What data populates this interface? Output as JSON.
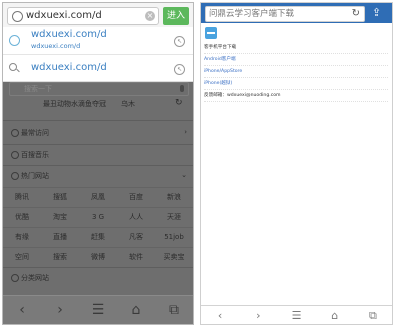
{
  "left_screen": {
    "url_value": "wdxuexi.com/d",
    "go_label": "进入",
    "suggestions": [
      {
        "title": "wdxuexi.com/d",
        "subtitle": "wdxuexi.com/d"
      },
      {
        "title": "wdxuexi.com/d"
      }
    ],
    "search_placeholder": "搜索一下",
    "news": [
      "最丑动物水滴鱼夺冠",
      "乌木"
    ],
    "sections": {
      "frequent": "最常访问",
      "music": "百搜音乐",
      "hot_sites": "热门网站",
      "categories": "分类网站"
    },
    "hot_grid": [
      [
        "腾讯",
        "搜狐",
        "凤凰",
        "百度",
        "新浪"
      ],
      [
        "优酷",
        "淘宝",
        "3 G",
        "人人",
        "天涯"
      ],
      [
        "有缘",
        "直播",
        "赶集",
        "凡客",
        "51job"
      ],
      [
        "空间",
        "搜索",
        "微博",
        "软件",
        "买卖宝"
      ]
    ],
    "bottom_nav": [
      {
        "icon": "back-icon",
        "glyph": "‹"
      },
      {
        "icon": "forward-icon",
        "glyph": "›"
      },
      {
        "icon": "menu-icon",
        "glyph": "☰"
      },
      {
        "icon": "home-icon",
        "glyph": "⌂"
      },
      {
        "icon": "tabs-icon",
        "glyph": "⧉"
      }
    ]
  },
  "right_screen": {
    "search_placeholder": "问鼎云学习客户端下载",
    "lines": [
      {
        "text": "客手机平台下载",
        "style": "dark"
      },
      {
        "text": "Android客户端",
        "style": "link"
      },
      {
        "text": "iPhone/AppStore",
        "style": "link"
      },
      {
        "text": "iPhone(越狱)",
        "style": "link"
      },
      {
        "text": "反馈邮箱：wdxuexi@nuoding.com",
        "style": "dark"
      }
    ],
    "bottom_nav": [
      {
        "icon": "back-icon",
        "glyph": "‹"
      },
      {
        "icon": "forward-icon",
        "glyph": "›"
      },
      {
        "icon": "menu-icon",
        "glyph": "☰"
      },
      {
        "icon": "home-icon",
        "glyph": "⌂"
      },
      {
        "icon": "tabs-icon",
        "glyph": "⧉"
      }
    ]
  },
  "colors": {
    "go_button": "#5cb85c",
    "suggest_text": "#3a7fc1",
    "right_topbar": "#2f6db5",
    "link": "#3a6fc4"
  }
}
